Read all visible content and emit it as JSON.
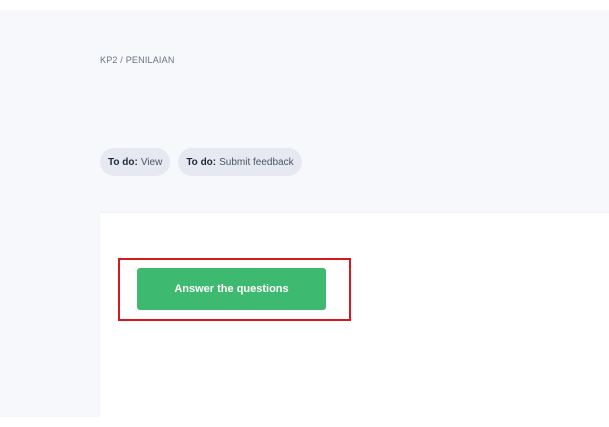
{
  "breadcrumb": "KP2 / PENILAIAN",
  "todos": [
    {
      "key": "To do:",
      "value": "View"
    },
    {
      "key": "To do:",
      "value": "Submit feedback"
    }
  ],
  "actions": {
    "answer_label": "Answer the questions"
  },
  "colors": {
    "page_background": "#f7f8fc",
    "chip_background": "#e6e9f2",
    "button_green": "#3dba6f",
    "highlight_red": "#d7191f"
  }
}
